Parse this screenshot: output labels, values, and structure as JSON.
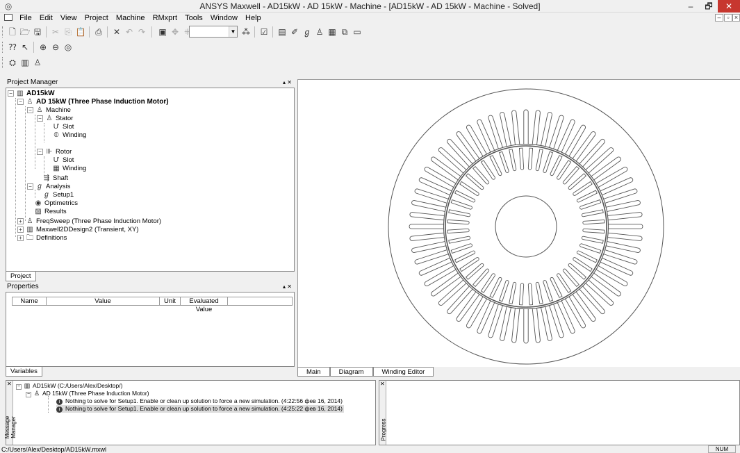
{
  "window": {
    "title": "ANSYS Maxwell - AD15kW - AD 15kW - Machine - [AD15kW - AD 15kW - Machine - Solved]",
    "minimize": "–",
    "maximize": "🗗",
    "close": "✕"
  },
  "menu": {
    "items": [
      "File",
      "Edit",
      "View",
      "Project",
      "Machine",
      "RMxprt",
      "Tools",
      "Window",
      "Help"
    ]
  },
  "project_manager": {
    "title": "Project Manager",
    "controls": "▴ ✕",
    "tree": [
      {
        "label": "AD15kW",
        "bold": true
      },
      {
        "label": "AD 15kW (Three Phase Induction Motor)",
        "bold": true
      },
      {
        "label": "Machine"
      },
      {
        "label": "Stator"
      },
      {
        "label": "Slot"
      },
      {
        "label": "Winding"
      },
      {
        "label": "Rotor"
      },
      {
        "label": "Slot"
      },
      {
        "label": "Winding"
      },
      {
        "label": "Shaft"
      },
      {
        "label": "Analysis"
      },
      {
        "label": "Setup1"
      },
      {
        "label": "Optimetrics"
      },
      {
        "label": "Results"
      },
      {
        "label": "FreqSweep (Three Phase Induction Motor)"
      },
      {
        "label": "Maxwell2DDesign2 (Transient, XY)"
      },
      {
        "label": "Definitions"
      }
    ],
    "tab": "Project"
  },
  "properties": {
    "title": "Properties",
    "controls": "▴ ✕",
    "columns": [
      "Name",
      "Value",
      "Unit",
      "Evaluated Value"
    ],
    "tab": "Variables"
  },
  "view_tabs": [
    "Main",
    "Diagram",
    "Winding Editor"
  ],
  "message_manager": {
    "side_label": "Message Manager",
    "rows": [
      "AD15kW (C:/Users/Alex/Desktop/)",
      "AD 15kW (Three Phase Induction Motor)",
      "Nothing to solve for Setup1. Enable or clean up solution to force a new simulation. (4:22:56  фев 16, 2014)",
      "Nothing to solve for Setup1. Enable or clean up solution to force a new simulation. (4:25:22  фев 16, 2014)"
    ]
  },
  "progress": {
    "side_label": "Progress"
  },
  "status": {
    "path": "C:/Users/Alex/Desktop/AD15kW.mxwl",
    "num": "NUM"
  },
  "drawing": {
    "stator_slots": 60,
    "rotor_slots": 48,
    "line_color": "#555555"
  }
}
